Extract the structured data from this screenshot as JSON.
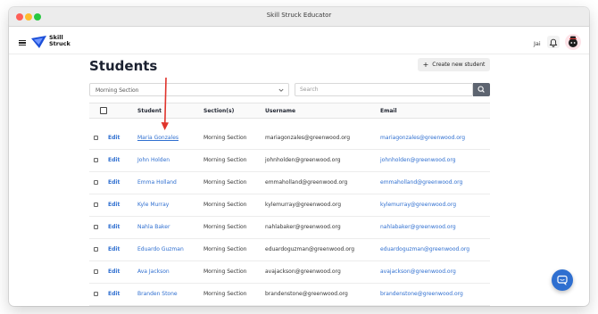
{
  "window": {
    "title": "Skill Struck Educator"
  },
  "brand": {
    "line1": "Skill",
    "line2": "Struck",
    "color": "#1b4fd8"
  },
  "header": {
    "user_name": "Jai"
  },
  "page": {
    "title": "Students",
    "create_button_label": "Create new student",
    "section_filter": {
      "selected": "Morning Section"
    },
    "search": {
      "placeholder": "Search",
      "value": ""
    }
  },
  "table": {
    "columns": {
      "student": "Student",
      "sections": "Section(s)",
      "username": "Username",
      "email": "Email"
    },
    "rows": [
      {
        "edit": "Edit",
        "student": "Maria Gonzales",
        "section": "Morning Section",
        "username": "mariagonzales@greenwood.org",
        "email": "mariagonzales@greenwood.org"
      },
      {
        "edit": "Edit",
        "student": "John Holden",
        "section": "Morning Section",
        "username": "johnholden@greenwood.org",
        "email": "johnholden@greenwood.org"
      },
      {
        "edit": "Edit",
        "student": "Emma Holland",
        "section": "Morning Section",
        "username": "emmaholland@greenwood.org",
        "email": "emmaholland@greenwood.org"
      },
      {
        "edit": "Edit",
        "student": "Kyle Murray",
        "section": "Morning Section",
        "username": "kylemurray@greenwood.org",
        "email": "kylemurray@greenwood.org"
      },
      {
        "edit": "Edit",
        "student": "Nahla Baker",
        "section": "Morning Section",
        "username": "nahlabaker@greenwood.org",
        "email": "nahlabaker@greenwood.org"
      },
      {
        "edit": "Edit",
        "student": "Eduardo Guzman",
        "section": "Morning Section",
        "username": "eduardoguzman@greenwood.org",
        "email": "eduardoguzman@greenwood.org"
      },
      {
        "edit": "Edit",
        "student": "Ava Jackson",
        "section": "Morning Section",
        "username": "avajackson@greenwood.org",
        "email": "avajackson@greenwood.org"
      },
      {
        "edit": "Edit",
        "student": "Branden Stone",
        "section": "Morning Section",
        "username": "brandenstone@greenwood.org",
        "email": "brandenstone@greenwood.org"
      }
    ]
  },
  "icons": {
    "menu": "hamburger-menu-icon",
    "bell": "bell-icon",
    "search": "search-icon",
    "chevron": "chevron-down-icon",
    "chat": "chat-icon",
    "annotation": "red-arrow-annotation"
  },
  "colors": {
    "link": "#2f6fd0",
    "annotation": "#e0342c",
    "search_button": "#5d6470"
  }
}
